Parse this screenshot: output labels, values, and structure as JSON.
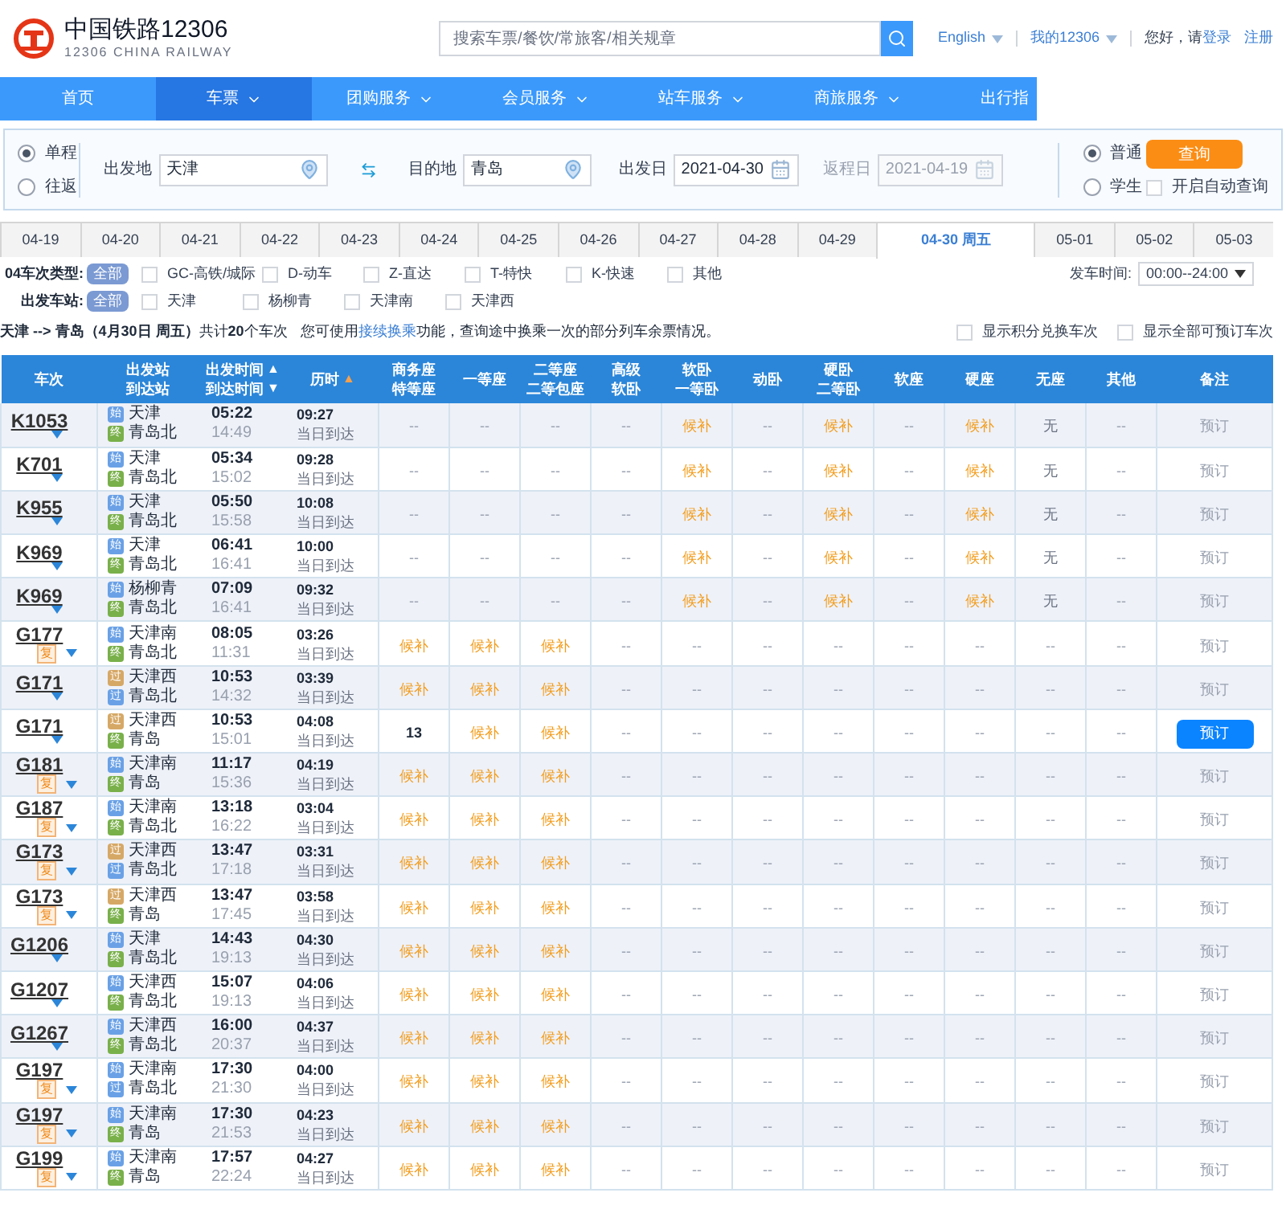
{
  "header": {
    "logo_title": "中国铁路12306",
    "logo_subtitle": "12306 CHINA RAILWAY",
    "search_placeholder": "搜索车票/餐饮/常旅客/相关规章",
    "links": [
      {
        "text": "English",
        "dropdown": true
      },
      {
        "text": "我的12306",
        "dropdown": true
      }
    ],
    "greeting": "您好，请",
    "login": "登录",
    "register": "注册"
  },
  "nav": [
    {
      "label": "首页",
      "dropdown": false,
      "selected": false
    },
    {
      "label": "车票",
      "dropdown": true,
      "selected": true
    },
    {
      "label": "团购服务",
      "dropdown": true,
      "selected": false
    },
    {
      "label": "会员服务",
      "dropdown": true,
      "selected": false
    },
    {
      "label": "站车服务",
      "dropdown": true,
      "selected": false
    },
    {
      "label": "商旅服务",
      "dropdown": true,
      "selected": false
    },
    {
      "label": "出行指",
      "dropdown": false,
      "selected": false
    }
  ],
  "query": {
    "trip_types": [
      {
        "label": "单程",
        "selected": true
      },
      {
        "label": "往返",
        "selected": false
      }
    ],
    "from": {
      "label": "出发地",
      "value": "天津"
    },
    "to": {
      "label": "目的地",
      "value": "青岛"
    },
    "depart_date": {
      "label": "出发日",
      "value": "2021-04-30",
      "disabled": false
    },
    "return_date": {
      "label": "返程日",
      "value": "2021-04-19",
      "disabled": true
    },
    "passenger_types": [
      {
        "label": "普通",
        "selected": true
      },
      {
        "label": "学生",
        "selected": false
      }
    ],
    "search_button": "查询",
    "auto_query": {
      "label": "开启自动查询",
      "checked": false
    }
  },
  "date_tabs": [
    {
      "label": "04-19",
      "selected": false
    },
    {
      "label": "04-20",
      "selected": false
    },
    {
      "label": "04-21",
      "selected": false
    },
    {
      "label": "04-22",
      "selected": false
    },
    {
      "label": "04-23",
      "selected": false
    },
    {
      "label": "04-24",
      "selected": false
    },
    {
      "label": "04-25",
      "selected": false
    },
    {
      "label": "04-26",
      "selected": false
    },
    {
      "label": "04-27",
      "selected": false
    },
    {
      "label": "04-28",
      "selected": false
    },
    {
      "label": "04-29",
      "selected": false
    },
    {
      "label": "04-30 周五",
      "selected": true
    },
    {
      "label": "05-01",
      "selected": false
    },
    {
      "label": "05-02",
      "selected": false
    },
    {
      "label": "05-03",
      "selected": false
    }
  ],
  "filters": {
    "train_type": {
      "label": "04车次类型:",
      "all": {
        "label": "全部",
        "selected": true
      },
      "options": [
        {
          "label": "GC-高铁/城际",
          "checked": false
        },
        {
          "label": "D-动车",
          "checked": false
        },
        {
          "label": "Z-直达",
          "checked": false
        },
        {
          "label": "T-特快",
          "checked": false
        },
        {
          "label": "K-快速",
          "checked": false
        },
        {
          "label": "其他",
          "checked": false
        }
      ]
    },
    "depart_time": {
      "label": "发车时间:",
      "value": "00:00--24:00"
    },
    "station": {
      "label": "出发车站:",
      "all": {
        "label": "全部",
        "selected": true
      },
      "options": [
        {
          "label": "天津",
          "checked": false
        },
        {
          "label": "杨柳青",
          "checked": false
        },
        {
          "label": "天津南",
          "checked": false
        },
        {
          "label": "天津西",
          "checked": false
        }
      ]
    }
  },
  "summary": {
    "route": "**天津 --> 青岛（4月30日 周五）**共计**20**个车次",
    "hint_before": "您可使用",
    "hint_link": "接续换乘",
    "hint_after": "功能，查询途中换乘一次的部分列车余票情况。",
    "toggles": [
      {
        "label": "显示积分兑换车次",
        "checked": false
      },
      {
        "label": "显示全部可预订车次",
        "checked": false
      }
    ]
  },
  "table": {
    "columns": [
      {
        "lines": [
          "车次"
        ]
      },
      {
        "lines": [
          "出发站",
          "到达站"
        ]
      },
      {
        "lines": [
          "出发时间",
          "到达时间"
        ],
        "sort": [
          "▲",
          "▼"
        ]
      },
      {
        "lines": [
          "历时"
        ],
        "sort": [
          "▲"
        ],
        "sort_active": true
      },
      {
        "lines": [
          "商务座",
          "特等座"
        ]
      },
      {
        "lines": [
          "一等座"
        ]
      },
      {
        "lines": [
          "二等座",
          "二等包座"
        ]
      },
      {
        "lines": [
          "高级",
          "软卧"
        ]
      },
      {
        "lines": [
          "软卧",
          "一等卧"
        ]
      },
      {
        "lines": [
          "动卧"
        ]
      },
      {
        "lines": [
          "硬卧",
          "二等卧"
        ]
      },
      {
        "lines": [
          "软座"
        ]
      },
      {
        "lines": [
          "硬座"
        ]
      },
      {
        "lines": [
          "无座"
        ]
      },
      {
        "lines": [
          "其他"
        ]
      },
      {
        "lines": [
          "备注"
        ]
      }
    ],
    "rows": [
      {
        "train": "K1053",
        "reissue": null,
        "from": {
          "name": "天津",
          "badge": "始",
          "color": "#6aa1e6"
        },
        "to": {
          "name": "青岛北",
          "badge": "终",
          "color": "#79b04a"
        },
        "depart": "05:22",
        "arrive": "14:49",
        "duration": "09:27",
        "arrival_day": "当日到达",
        "seats": [
          {
            "text": "--",
            "kind": "none"
          },
          {
            "text": "--",
            "kind": "none"
          },
          {
            "text": "--",
            "kind": "none"
          },
          {
            "text": "--",
            "kind": "none"
          },
          {
            "text": "候补",
            "kind": "waitlist"
          },
          {
            "text": "--",
            "kind": "none"
          },
          {
            "text": "候补",
            "kind": "waitlist"
          },
          {
            "text": "--",
            "kind": "none"
          },
          {
            "text": "候补",
            "kind": "waitlist"
          },
          {
            "text": "无",
            "kind": "soldout"
          },
          {
            "text": "--",
            "kind": "none"
          }
        ],
        "action": {
          "text": "预订",
          "enabled": false
        }
      },
      {
        "train": "K701",
        "reissue": null,
        "from": {
          "name": "天津",
          "badge": "始",
          "color": "#6aa1e6"
        },
        "to": {
          "name": "青岛北",
          "badge": "终",
          "color": "#79b04a"
        },
        "depart": "05:34",
        "arrive": "15:02",
        "duration": "09:28",
        "arrival_day": "当日到达",
        "seats": [
          {
            "text": "--",
            "kind": "none"
          },
          {
            "text": "--",
            "kind": "none"
          },
          {
            "text": "--",
            "kind": "none"
          },
          {
            "text": "--",
            "kind": "none"
          },
          {
            "text": "候补",
            "kind": "waitlist"
          },
          {
            "text": "--",
            "kind": "none"
          },
          {
            "text": "候补",
            "kind": "waitlist"
          },
          {
            "text": "--",
            "kind": "none"
          },
          {
            "text": "候补",
            "kind": "waitlist"
          },
          {
            "text": "无",
            "kind": "soldout"
          },
          {
            "text": "--",
            "kind": "none"
          }
        ],
        "action": {
          "text": "预订",
          "enabled": false
        }
      },
      {
        "train": "K955",
        "reissue": null,
        "from": {
          "name": "天津",
          "badge": "始",
          "color": "#6aa1e6"
        },
        "to": {
          "name": "青岛北",
          "badge": "终",
          "color": "#79b04a"
        },
        "depart": "05:50",
        "arrive": "15:58",
        "duration": "10:08",
        "arrival_day": "当日到达",
        "seats": [
          {
            "text": "--",
            "kind": "none"
          },
          {
            "text": "--",
            "kind": "none"
          },
          {
            "text": "--",
            "kind": "none"
          },
          {
            "text": "--",
            "kind": "none"
          },
          {
            "text": "候补",
            "kind": "waitlist"
          },
          {
            "text": "--",
            "kind": "none"
          },
          {
            "text": "候补",
            "kind": "waitlist"
          },
          {
            "text": "--",
            "kind": "none"
          },
          {
            "text": "候补",
            "kind": "waitlist"
          },
          {
            "text": "无",
            "kind": "soldout"
          },
          {
            "text": "--",
            "kind": "none"
          }
        ],
        "action": {
          "text": "预订",
          "enabled": false
        }
      },
      {
        "train": "K969",
        "reissue": null,
        "from": {
          "name": "天津",
          "badge": "始",
          "color": "#6aa1e6"
        },
        "to": {
          "name": "青岛北",
          "badge": "终",
          "color": "#79b04a"
        },
        "depart": "06:41",
        "arrive": "16:41",
        "duration": "10:00",
        "arrival_day": "当日到达",
        "seats": [
          {
            "text": "--",
            "kind": "none"
          },
          {
            "text": "--",
            "kind": "none"
          },
          {
            "text": "--",
            "kind": "none"
          },
          {
            "text": "--",
            "kind": "none"
          },
          {
            "text": "候补",
            "kind": "waitlist"
          },
          {
            "text": "--",
            "kind": "none"
          },
          {
            "text": "候补",
            "kind": "waitlist"
          },
          {
            "text": "--",
            "kind": "none"
          },
          {
            "text": "候补",
            "kind": "waitlist"
          },
          {
            "text": "无",
            "kind": "soldout"
          },
          {
            "text": "--",
            "kind": "none"
          }
        ],
        "action": {
          "text": "预订",
          "enabled": false
        }
      },
      {
        "train": "K969",
        "reissue": null,
        "from": {
          "name": "杨柳青",
          "badge": "始",
          "color": "#6aa1e6"
        },
        "to": {
          "name": "青岛北",
          "badge": "终",
          "color": "#79b04a"
        },
        "depart": "07:09",
        "arrive": "16:41",
        "duration": "09:32",
        "arrival_day": "当日到达",
        "seats": [
          {
            "text": "--",
            "kind": "none"
          },
          {
            "text": "--",
            "kind": "none"
          },
          {
            "text": "--",
            "kind": "none"
          },
          {
            "text": "--",
            "kind": "none"
          },
          {
            "text": "候补",
            "kind": "waitlist"
          },
          {
            "text": "--",
            "kind": "none"
          },
          {
            "text": "候补",
            "kind": "waitlist"
          },
          {
            "text": "--",
            "kind": "none"
          },
          {
            "text": "候补",
            "kind": "waitlist"
          },
          {
            "text": "无",
            "kind": "soldout"
          },
          {
            "text": "--",
            "kind": "none"
          }
        ],
        "action": {
          "text": "预订",
          "enabled": false
        }
      },
      {
        "train": "G177",
        "reissue": "复",
        "from": {
          "name": "天津南",
          "badge": "始",
          "color": "#6aa1e6"
        },
        "to": {
          "name": "青岛北",
          "badge": "终",
          "color": "#79b04a"
        },
        "depart": "08:05",
        "arrive": "11:31",
        "duration": "03:26",
        "arrival_day": "当日到达",
        "seats": [
          {
            "text": "候补",
            "kind": "waitlist"
          },
          {
            "text": "候补",
            "kind": "waitlist"
          },
          {
            "text": "候补",
            "kind": "waitlist"
          },
          {
            "text": "--",
            "kind": "none"
          },
          {
            "text": "--",
            "kind": "none"
          },
          {
            "text": "--",
            "kind": "none"
          },
          {
            "text": "--",
            "kind": "none"
          },
          {
            "text": "--",
            "kind": "none"
          },
          {
            "text": "--",
            "kind": "none"
          },
          {
            "text": "--",
            "kind": "none"
          },
          {
            "text": "--",
            "kind": "none"
          }
        ],
        "action": {
          "text": "预订",
          "enabled": false
        }
      },
      {
        "train": "G171",
        "reissue": null,
        "from": {
          "name": "天津西",
          "badge": "过",
          "color": "#d6a866"
        },
        "to": {
          "name": "青岛北",
          "badge": "过",
          "color": "#6aa1e6"
        },
        "depart": "10:53",
        "arrive": "14:32",
        "duration": "03:39",
        "arrival_day": "当日到达",
        "seats": [
          {
            "text": "候补",
            "kind": "waitlist"
          },
          {
            "text": "候补",
            "kind": "waitlist"
          },
          {
            "text": "候补",
            "kind": "waitlist"
          },
          {
            "text": "--",
            "kind": "none"
          },
          {
            "text": "--",
            "kind": "none"
          },
          {
            "text": "--",
            "kind": "none"
          },
          {
            "text": "--",
            "kind": "none"
          },
          {
            "text": "--",
            "kind": "none"
          },
          {
            "text": "--",
            "kind": "none"
          },
          {
            "text": "--",
            "kind": "none"
          },
          {
            "text": "--",
            "kind": "none"
          }
        ],
        "action": {
          "text": "预订",
          "enabled": false
        }
      },
      {
        "train": "G171",
        "reissue": null,
        "from": {
          "name": "天津西",
          "badge": "过",
          "color": "#d6a866"
        },
        "to": {
          "name": "青岛",
          "badge": "终",
          "color": "#79b04a"
        },
        "depart": "10:53",
        "arrive": "15:01",
        "duration": "04:08",
        "arrival_day": "当日到达",
        "seats": [
          {
            "text": "13",
            "kind": "count"
          },
          {
            "text": "候补",
            "kind": "waitlist"
          },
          {
            "text": "候补",
            "kind": "waitlist"
          },
          {
            "text": "--",
            "kind": "none"
          },
          {
            "text": "--",
            "kind": "none"
          },
          {
            "text": "--",
            "kind": "none"
          },
          {
            "text": "--",
            "kind": "none"
          },
          {
            "text": "--",
            "kind": "none"
          },
          {
            "text": "--",
            "kind": "none"
          },
          {
            "text": "--",
            "kind": "none"
          },
          {
            "text": "--",
            "kind": "none"
          }
        ],
        "action": {
          "text": "预订",
          "enabled": true
        }
      },
      {
        "train": "G181",
        "reissue": "复",
        "from": {
          "name": "天津南",
          "badge": "始",
          "color": "#6aa1e6"
        },
        "to": {
          "name": "青岛",
          "badge": "终",
          "color": "#79b04a"
        },
        "depart": "11:17",
        "arrive": "15:36",
        "duration": "04:19",
        "arrival_day": "当日到达",
        "seats": [
          {
            "text": "候补",
            "kind": "waitlist"
          },
          {
            "text": "候补",
            "kind": "waitlist"
          },
          {
            "text": "候补",
            "kind": "waitlist"
          },
          {
            "text": "--",
            "kind": "none"
          },
          {
            "text": "--",
            "kind": "none"
          },
          {
            "text": "--",
            "kind": "none"
          },
          {
            "text": "--",
            "kind": "none"
          },
          {
            "text": "--",
            "kind": "none"
          },
          {
            "text": "--",
            "kind": "none"
          },
          {
            "text": "--",
            "kind": "none"
          },
          {
            "text": "--",
            "kind": "none"
          }
        ],
        "action": {
          "text": "预订",
          "enabled": false
        }
      },
      {
        "train": "G187",
        "reissue": "复",
        "from": {
          "name": "天津南",
          "badge": "始",
          "color": "#6aa1e6"
        },
        "to": {
          "name": "青岛北",
          "badge": "终",
          "color": "#79b04a"
        },
        "depart": "13:18",
        "arrive": "16:22",
        "duration": "03:04",
        "arrival_day": "当日到达",
        "seats": [
          {
            "text": "候补",
            "kind": "waitlist"
          },
          {
            "text": "候补",
            "kind": "waitlist"
          },
          {
            "text": "候补",
            "kind": "waitlist"
          },
          {
            "text": "--",
            "kind": "none"
          },
          {
            "text": "--",
            "kind": "none"
          },
          {
            "text": "--",
            "kind": "none"
          },
          {
            "text": "--",
            "kind": "none"
          },
          {
            "text": "--",
            "kind": "none"
          },
          {
            "text": "--",
            "kind": "none"
          },
          {
            "text": "--",
            "kind": "none"
          },
          {
            "text": "--",
            "kind": "none"
          }
        ],
        "action": {
          "text": "预订",
          "enabled": false
        }
      },
      {
        "train": "G173",
        "reissue": "复",
        "from": {
          "name": "天津西",
          "badge": "过",
          "color": "#d6a866"
        },
        "to": {
          "name": "青岛北",
          "badge": "过",
          "color": "#6aa1e6"
        },
        "depart": "13:47",
        "arrive": "17:18",
        "duration": "03:31",
        "arrival_day": "当日到达",
        "seats": [
          {
            "text": "候补",
            "kind": "waitlist"
          },
          {
            "text": "候补",
            "kind": "waitlist"
          },
          {
            "text": "候补",
            "kind": "waitlist"
          },
          {
            "text": "--",
            "kind": "none"
          },
          {
            "text": "--",
            "kind": "none"
          },
          {
            "text": "--",
            "kind": "none"
          },
          {
            "text": "--",
            "kind": "none"
          },
          {
            "text": "--",
            "kind": "none"
          },
          {
            "text": "--",
            "kind": "none"
          },
          {
            "text": "--",
            "kind": "none"
          },
          {
            "text": "--",
            "kind": "none"
          }
        ],
        "action": {
          "text": "预订",
          "enabled": false
        }
      },
      {
        "train": "G173",
        "reissue": "复",
        "from": {
          "name": "天津西",
          "badge": "过",
          "color": "#d6a866"
        },
        "to": {
          "name": "青岛",
          "badge": "终",
          "color": "#79b04a"
        },
        "depart": "13:47",
        "arrive": "17:45",
        "duration": "03:58",
        "arrival_day": "当日到达",
        "seats": [
          {
            "text": "候补",
            "kind": "waitlist"
          },
          {
            "text": "候补",
            "kind": "waitlist"
          },
          {
            "text": "候补",
            "kind": "waitlist"
          },
          {
            "text": "--",
            "kind": "none"
          },
          {
            "text": "--",
            "kind": "none"
          },
          {
            "text": "--",
            "kind": "none"
          },
          {
            "text": "--",
            "kind": "none"
          },
          {
            "text": "--",
            "kind": "none"
          },
          {
            "text": "--",
            "kind": "none"
          },
          {
            "text": "--",
            "kind": "none"
          },
          {
            "text": "--",
            "kind": "none"
          }
        ],
        "action": {
          "text": "预订",
          "enabled": false
        }
      },
      {
        "train": "G1206",
        "reissue": null,
        "from": {
          "name": "天津",
          "badge": "始",
          "color": "#6aa1e6"
        },
        "to": {
          "name": "青岛北",
          "badge": "终",
          "color": "#79b04a"
        },
        "depart": "14:43",
        "arrive": "19:13",
        "duration": "04:30",
        "arrival_day": "当日到达",
        "seats": [
          {
            "text": "候补",
            "kind": "waitlist"
          },
          {
            "text": "候补",
            "kind": "waitlist"
          },
          {
            "text": "候补",
            "kind": "waitlist"
          },
          {
            "text": "--",
            "kind": "none"
          },
          {
            "text": "--",
            "kind": "none"
          },
          {
            "text": "--",
            "kind": "none"
          },
          {
            "text": "--",
            "kind": "none"
          },
          {
            "text": "--",
            "kind": "none"
          },
          {
            "text": "--",
            "kind": "none"
          },
          {
            "text": "--",
            "kind": "none"
          },
          {
            "text": "--",
            "kind": "none"
          }
        ],
        "action": {
          "text": "预订",
          "enabled": false
        }
      },
      {
        "train": "G1207",
        "reissue": null,
        "from": {
          "name": "天津西",
          "badge": "始",
          "color": "#6aa1e6"
        },
        "to": {
          "name": "青岛北",
          "badge": "终",
          "color": "#79b04a"
        },
        "depart": "15:07",
        "arrive": "19:13",
        "duration": "04:06",
        "arrival_day": "当日到达",
        "seats": [
          {
            "text": "候补",
            "kind": "waitlist"
          },
          {
            "text": "候补",
            "kind": "waitlist"
          },
          {
            "text": "候补",
            "kind": "waitlist"
          },
          {
            "text": "--",
            "kind": "none"
          },
          {
            "text": "--",
            "kind": "none"
          },
          {
            "text": "--",
            "kind": "none"
          },
          {
            "text": "--",
            "kind": "none"
          },
          {
            "text": "--",
            "kind": "none"
          },
          {
            "text": "--",
            "kind": "none"
          },
          {
            "text": "--",
            "kind": "none"
          },
          {
            "text": "--",
            "kind": "none"
          }
        ],
        "action": {
          "text": "预订",
          "enabled": false
        }
      },
      {
        "train": "G1267",
        "reissue": null,
        "from": {
          "name": "天津西",
          "badge": "始",
          "color": "#6aa1e6"
        },
        "to": {
          "name": "青岛北",
          "badge": "终",
          "color": "#79b04a"
        },
        "depart": "16:00",
        "arrive": "20:37",
        "duration": "04:37",
        "arrival_day": "当日到达",
        "seats": [
          {
            "text": "候补",
            "kind": "waitlist"
          },
          {
            "text": "候补",
            "kind": "waitlist"
          },
          {
            "text": "候补",
            "kind": "waitlist"
          },
          {
            "text": "--",
            "kind": "none"
          },
          {
            "text": "--",
            "kind": "none"
          },
          {
            "text": "--",
            "kind": "none"
          },
          {
            "text": "--",
            "kind": "none"
          },
          {
            "text": "--",
            "kind": "none"
          },
          {
            "text": "--",
            "kind": "none"
          },
          {
            "text": "--",
            "kind": "none"
          },
          {
            "text": "--",
            "kind": "none"
          }
        ],
        "action": {
          "text": "预订",
          "enabled": false
        }
      },
      {
        "train": "G197",
        "reissue": "复",
        "from": {
          "name": "天津南",
          "badge": "始",
          "color": "#6aa1e6"
        },
        "to": {
          "name": "青岛北",
          "badge": "过",
          "color": "#6aa1e6"
        },
        "depart": "17:30",
        "arrive": "21:30",
        "duration": "04:00",
        "arrival_day": "当日到达",
        "seats": [
          {
            "text": "候补",
            "kind": "waitlist"
          },
          {
            "text": "候补",
            "kind": "waitlist"
          },
          {
            "text": "候补",
            "kind": "waitlist"
          },
          {
            "text": "--",
            "kind": "none"
          },
          {
            "text": "--",
            "kind": "none"
          },
          {
            "text": "--",
            "kind": "none"
          },
          {
            "text": "--",
            "kind": "none"
          },
          {
            "text": "--",
            "kind": "none"
          },
          {
            "text": "--",
            "kind": "none"
          },
          {
            "text": "--",
            "kind": "none"
          },
          {
            "text": "--",
            "kind": "none"
          }
        ],
        "action": {
          "text": "预订",
          "enabled": false
        }
      },
      {
        "train": "G197",
        "reissue": "复",
        "from": {
          "name": "天津南",
          "badge": "始",
          "color": "#6aa1e6"
        },
        "to": {
          "name": "青岛",
          "badge": "终",
          "color": "#79b04a"
        },
        "depart": "17:30",
        "arrive": "21:53",
        "duration": "04:23",
        "arrival_day": "当日到达",
        "seats": [
          {
            "text": "候补",
            "kind": "waitlist"
          },
          {
            "text": "候补",
            "kind": "waitlist"
          },
          {
            "text": "候补",
            "kind": "waitlist"
          },
          {
            "text": "--",
            "kind": "none"
          },
          {
            "text": "--",
            "kind": "none"
          },
          {
            "text": "--",
            "kind": "none"
          },
          {
            "text": "--",
            "kind": "none"
          },
          {
            "text": "--",
            "kind": "none"
          },
          {
            "text": "--",
            "kind": "none"
          },
          {
            "text": "--",
            "kind": "none"
          },
          {
            "text": "--",
            "kind": "none"
          }
        ],
        "action": {
          "text": "预订",
          "enabled": false
        }
      },
      {
        "train": "G199",
        "reissue": "复",
        "from": {
          "name": "天津南",
          "badge": "始",
          "color": "#6aa1e6"
        },
        "to": {
          "name": "青岛",
          "badge": "终",
          "color": "#79b04a"
        },
        "depart": "17:57",
        "arrive": "22:24",
        "duration": "04:27",
        "arrival_day": "当日到达",
        "seats": [
          {
            "text": "候补",
            "kind": "waitlist"
          },
          {
            "text": "候补",
            "kind": "waitlist"
          },
          {
            "text": "候补",
            "kind": "waitlist"
          },
          {
            "text": "--",
            "kind": "none"
          },
          {
            "text": "--",
            "kind": "none"
          },
          {
            "text": "--",
            "kind": "none"
          },
          {
            "text": "--",
            "kind": "none"
          },
          {
            "text": "--",
            "kind": "none"
          },
          {
            "text": "--",
            "kind": "none"
          },
          {
            "text": "--",
            "kind": "none"
          },
          {
            "text": "--",
            "kind": "none"
          }
        ],
        "action": {
          "text": "预订",
          "enabled": false
        }
      }
    ]
  }
}
